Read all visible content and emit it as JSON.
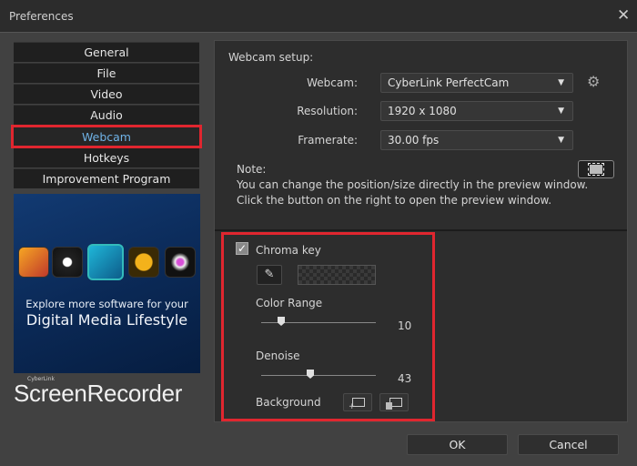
{
  "window": {
    "title": "Preferences"
  },
  "sidebar": {
    "items": [
      {
        "label": "General"
      },
      {
        "label": "File"
      },
      {
        "label": "Video"
      },
      {
        "label": "Audio"
      },
      {
        "label": "Webcam"
      },
      {
        "label": "Hotkeys"
      },
      {
        "label": "Improvement Program"
      }
    ],
    "active": "Webcam"
  },
  "banner": {
    "line1": "Explore more software for your",
    "line2": "Digital Media Lifestyle"
  },
  "brand": {
    "small": "CyberLink",
    "name": "ScreenRecorder"
  },
  "webcam_setup": {
    "heading": "Webcam setup:",
    "webcam_label": "Webcam:",
    "webcam_value": "CyberLink PerfectCam",
    "resolution_label": "Resolution:",
    "resolution_value": "1920 x 1080",
    "framerate_label": "Framerate:",
    "framerate_value": "30.00 fps",
    "note_title": "Note:",
    "note_line1": "You can change the position/size directly in the preview window.",
    "note_line2": "Click the button on the right to open the preview window."
  },
  "chroma": {
    "label": "Chroma key",
    "checked": true,
    "color_range_label": "Color Range",
    "color_range_value": "10",
    "denoise_label": "Denoise",
    "denoise_value": "43",
    "background_label": "Background"
  },
  "footer": {
    "ok": "OK",
    "cancel": "Cancel"
  },
  "colors": {
    "accent": "#6fb2e6",
    "highlight": "#e0262f"
  }
}
